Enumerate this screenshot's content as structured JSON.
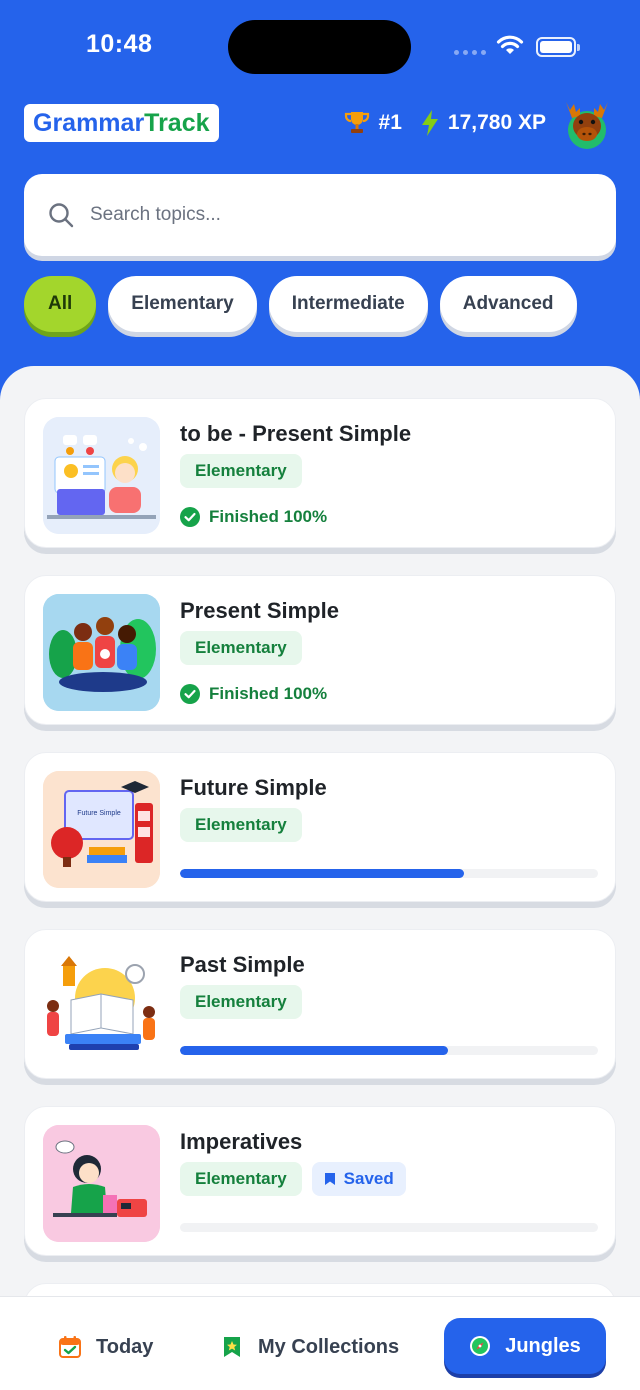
{
  "status_bar": {
    "time": "10:48"
  },
  "header": {
    "logo_part1": "Grammar",
    "logo_part2": "Track",
    "rank": "#1",
    "xp": "17,780 XP",
    "avatar_icon": "moose-avatar-icon"
  },
  "search": {
    "placeholder": "Search topics..."
  },
  "filters": [
    {
      "label": "All",
      "active": true
    },
    {
      "label": "Elementary",
      "active": false
    },
    {
      "label": "Intermediate",
      "active": false
    },
    {
      "label": "Advanced",
      "active": false
    }
  ],
  "topics": [
    {
      "title": "to be - Present Simple",
      "level": "Elementary",
      "status": "Finished 100%",
      "progress": 1.0
    },
    {
      "title": "Present Simple",
      "level": "Elementary",
      "status": "Finished 100%",
      "progress": 1.0
    },
    {
      "title": "Future Simple",
      "level": "Elementary",
      "progress": 0.68,
      "thumb_text": "Future Simple"
    },
    {
      "title": "Past Simple",
      "level": "Elementary",
      "progress": 0.64
    },
    {
      "title": "Imperatives",
      "level": "Elementary",
      "saved_label": "Saved",
      "progress": 0.0
    }
  ],
  "tabbar": {
    "today": "Today",
    "collections": "My Collections",
    "jungles": "Jungles"
  },
  "colors": {
    "primary": "#2563EB",
    "accent_green": "#A3D62C",
    "success": "#15803D",
    "badge_bg": "#E7F7EC"
  }
}
